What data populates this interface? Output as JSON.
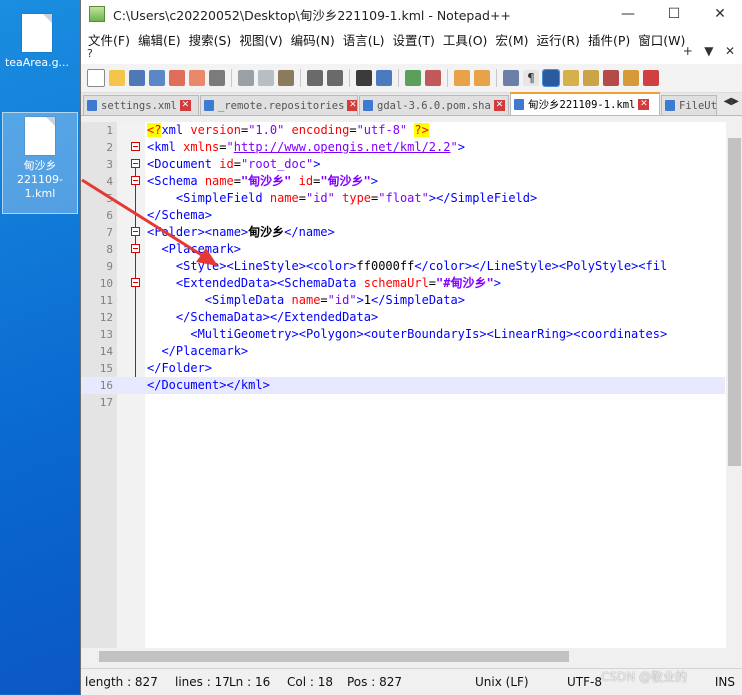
{
  "desktop": {
    "icons": [
      {
        "label": "teaArea.g..."
      },
      {
        "label": "甸沙乡221109-1.kml"
      }
    ]
  },
  "window": {
    "title": "C:\\Users\\c20220052\\Desktop\\甸沙乡221109-1.kml - Notepad++",
    "minimize": "—",
    "maximize": "☐",
    "close": "✕"
  },
  "menu": [
    "文件(F)",
    "编辑(E)",
    "搜索(S)",
    "视图(V)",
    "编码(N)",
    "语言(L)",
    "设置(T)",
    "工具(O)",
    "宏(M)",
    "运行(R)",
    "插件(P)",
    "窗口(W)"
  ],
  "menu_overflow": {
    "help": "?",
    "plus": "+",
    "dropdown": "▼",
    "close": "✕"
  },
  "tabs": [
    {
      "label": "settings.xml",
      "active": false
    },
    {
      "label": "_remote.repositories",
      "active": false
    },
    {
      "label": "gdal-3.6.0.pom.sha1",
      "active": false
    },
    {
      "label": "甸沙乡221109-1.kml",
      "active": true
    },
    {
      "label": "FileUt",
      "active": false
    }
  ],
  "editor": {
    "lines": [
      {
        "n": "1",
        "html": "<span class='pi'>&lt;?</span><span class='t'>xml</span> <span class='a'>version</span>=<span class='s'>\"1.0\"</span> <span class='a'>encoding</span>=<span class='s'>\"utf-8\"</span> <span class='pi'>?&gt;</span>"
      },
      {
        "n": "2",
        "html": "<span class='t'>&lt;kml</span> <span class='a'>xmlns</span>=<span class='s'>\"</span><span class='u'>http://www.opengis.net/kml/2.2</span><span class='s'>\"</span><span class='t'>&gt;</span>"
      },
      {
        "n": "3",
        "html": "<span class='t'>&lt;Document</span> <span class='a'>id</span>=<span class='s'>\"root_doc\"</span><span class='t'>&gt;</span>"
      },
      {
        "n": "4",
        "html": "<span class='t'>&lt;Schema</span> <span class='a'>name</span>=<span class='v'>\"甸沙乡\"</span> <span class='a'>id</span>=<span class='v'>\"甸沙乡\"</span><span class='t'>&gt;</span>"
      },
      {
        "n": "5",
        "html": "    <span class='t'>&lt;SimpleField</span> <span class='a'>name</span>=<span class='s'>\"id\"</span> <span class='a'>type</span>=<span class='s'>\"float\"</span><span class='t'>&gt;&lt;/SimpleField&gt;</span>"
      },
      {
        "n": "6",
        "html": "<span class='t'>&lt;/Schema&gt;</span>"
      },
      {
        "n": "7",
        "html": "<span class='t'>&lt;Folder&gt;&lt;name&gt;</span><span class='bt'>甸沙乡</span><span class='t'>&lt;/name&gt;</span>"
      },
      {
        "n": "8",
        "html": "  <span class='t'>&lt;Placemark&gt;</span>"
      },
      {
        "n": "9",
        "html": "    <span class='t'>&lt;Style&gt;&lt;LineStyle&gt;&lt;color&gt;</span>ff0000ff<span class='t'>&lt;/color&gt;&lt;/LineStyle&gt;&lt;PolyStyle&gt;&lt;fil</span>"
      },
      {
        "n": "10",
        "html": "    <span class='t'>&lt;ExtendedData&gt;&lt;SchemaData</span> <span class='a'>schemaUrl</span>=<span class='v'>\"#甸沙乡\"</span><span class='t'>&gt;</span>"
      },
      {
        "n": "11",
        "html": "        <span class='t'>&lt;SimpleData</span> <span class='a'>name</span>=<span class='s'>\"id\"</span><span class='t'>&gt;</span>1<span class='t'>&lt;/SimpleData&gt;</span>"
      },
      {
        "n": "12",
        "html": "    <span class='t'>&lt;/SchemaData&gt;&lt;/ExtendedData&gt;</span>"
      },
      {
        "n": "13",
        "html": "      <span class='t'>&lt;MultiGeometry&gt;&lt;Polygon&gt;&lt;outerBoundaryIs&gt;&lt;LinearRing&gt;&lt;coordinates&gt;</span>"
      },
      {
        "n": "14",
        "html": "  <span class='t'>&lt;/Placemark&gt;</span>"
      },
      {
        "n": "15",
        "html": "<span class='t'>&lt;/Folder&gt;</span>"
      },
      {
        "n": "16",
        "html": "<span class='t'>&lt;/Document&gt;&lt;/kml&gt;</span>"
      },
      {
        "n": "17",
        "html": ""
      }
    ],
    "current_line": 16
  },
  "status": {
    "length": "length : 827",
    "lines": "lines : 17",
    "ln": "Ln : 16",
    "col": "Col : 18",
    "pos": "Pos : 827",
    "eol": "Unix (LF)",
    "encoding": "UTF-8",
    "ins": "INS"
  },
  "watermark": "CSDN @敬业的",
  "colors": {
    "annotation_arrow": "#e53935",
    "tag": "#0000ff",
    "attribute": "#ff0000",
    "value": "#8000ff"
  }
}
